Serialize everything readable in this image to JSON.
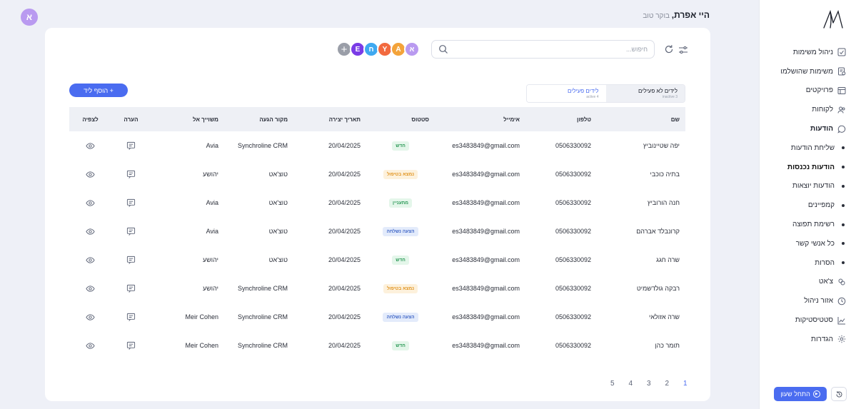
{
  "header": {
    "greeting_name": "היי אפרת,",
    "greeting_sub": " בוקר טוב",
    "user_initial": "א"
  },
  "sidebar": {
    "items": [
      {
        "label": "ניהול משימות",
        "icon": "tasks-icon",
        "type": "main"
      },
      {
        "label": "משימות שהושלמו",
        "icon": "completed-tasks-icon",
        "type": "main"
      },
      {
        "label": "פרויקטים",
        "icon": "projects-icon",
        "type": "main"
      },
      {
        "label": "לקוחות",
        "icon": "customers-icon",
        "type": "main"
      },
      {
        "label": "הודעות",
        "icon": "messages-icon",
        "type": "main-bold"
      },
      {
        "label": "שליחת הודעות",
        "type": "sub"
      },
      {
        "label": "הודעות נכנסות",
        "type": "sub-active"
      },
      {
        "label": "הודעות יוצאות",
        "type": "sub"
      },
      {
        "label": "קמפיינים",
        "type": "sub"
      },
      {
        "label": "רשימת תפוצה",
        "type": "sub"
      },
      {
        "label": "כל אנשי קשר",
        "type": "sub"
      },
      {
        "label": "הסרות",
        "type": "sub"
      },
      {
        "label": "צ'אט",
        "icon": "chat-icon",
        "type": "main"
      },
      {
        "label": "אזור ניהול",
        "icon": "admin-clock-icon",
        "type": "main"
      },
      {
        "label": "סטטיסטיקות",
        "icon": "stats-icon",
        "type": "main"
      },
      {
        "label": "הגדרות",
        "icon": "settings-icon",
        "type": "main"
      }
    ],
    "start_shift_label": "התחל שעון"
  },
  "toolbar": {
    "search_placeholder": "חיפוש...",
    "add_lead_label": "+ הוסף ליד",
    "avatars": [
      {
        "letter": "א",
        "color": "#b99af0"
      },
      {
        "letter": "A",
        "color": "#f3a33a"
      },
      {
        "letter": "Y",
        "color": "#f26a3f"
      },
      {
        "letter": "ח",
        "color": "#3fa9f0"
      },
      {
        "letter": "E",
        "color": "#7a3ce6"
      }
    ]
  },
  "tabs": [
    {
      "label": "לידים פעילים",
      "sub": "active 4",
      "active": true
    },
    {
      "label": "לידים לא פעילים",
      "sub": "inactive 3",
      "active": false
    }
  ],
  "table": {
    "headers": [
      "שם",
      "טלפון",
      "אימייל",
      "סטטוס",
      "תאריך יצירה",
      "מקור הגעה",
      "משוייך אל",
      "הערה",
      "לצפיה"
    ],
    "rows": [
      {
        "name": "יפה שטיינוביץ",
        "phone": "0506330092",
        "email": "es3483849@gmail.com",
        "status": "חדש",
        "status_type": "new",
        "date": "20/04/2025",
        "source": "Synchroline CRM",
        "assigned": "Avia"
      },
      {
        "name": "בתיה כוכבי",
        "phone": "0506330092",
        "email": "es3483849@gmail.com",
        "status": "נמצא בטיפול",
        "status_type": "treat",
        "date": "20/04/2025",
        "source": "טוצ'אט",
        "assigned": "יהושע"
      },
      {
        "name": "חנה הורוביץ",
        "phone": "0506330092",
        "email": "es3483849@gmail.com",
        "status": "מתעניין",
        "status_type": "int",
        "date": "20/04/2025",
        "source": "טוצ'אט",
        "assigned": "Avia"
      },
      {
        "name": "קרונבלד אברהם",
        "phone": "0506330092",
        "email": "es3483849@gmail.com",
        "status": "הצעה נשלחה",
        "status_type": "offer",
        "date": "20/04/2025",
        "source": "טוצ'אט",
        "assigned": "Avia"
      },
      {
        "name": "שרה חגג",
        "phone": "0506330092",
        "email": "es3483849@gmail.com",
        "status": "חדש",
        "status_type": "new",
        "date": "20/04/2025",
        "source": "טוצ'אט",
        "assigned": "יהושע"
      },
      {
        "name": "רבקה גולדשמיט",
        "phone": "0506330092",
        "email": "es3483849@gmail.com",
        "status": "נמצא בטיפול",
        "status_type": "treat",
        "date": "20/04/2025",
        "source": "Synchroline CRM",
        "assigned": "יהושע"
      },
      {
        "name": "שרה אזולאי",
        "phone": "0506330092",
        "email": "es3483849@gmail.com",
        "status": "הצעה נשלחה",
        "status_type": "offer",
        "date": "20/04/2025",
        "source": "Synchroline CRM",
        "assigned": "Meir Cohen"
      },
      {
        "name": "תומר כהן",
        "phone": "0506330092",
        "email": "es3483849@gmail.com",
        "status": "חדש",
        "status_type": "new",
        "date": "20/04/2025",
        "source": "Synchroline CRM",
        "assigned": "Meir Cohen"
      }
    ]
  },
  "pagination": {
    "pages": [
      "1",
      "2",
      "3",
      "4",
      "5"
    ],
    "active": "1"
  }
}
